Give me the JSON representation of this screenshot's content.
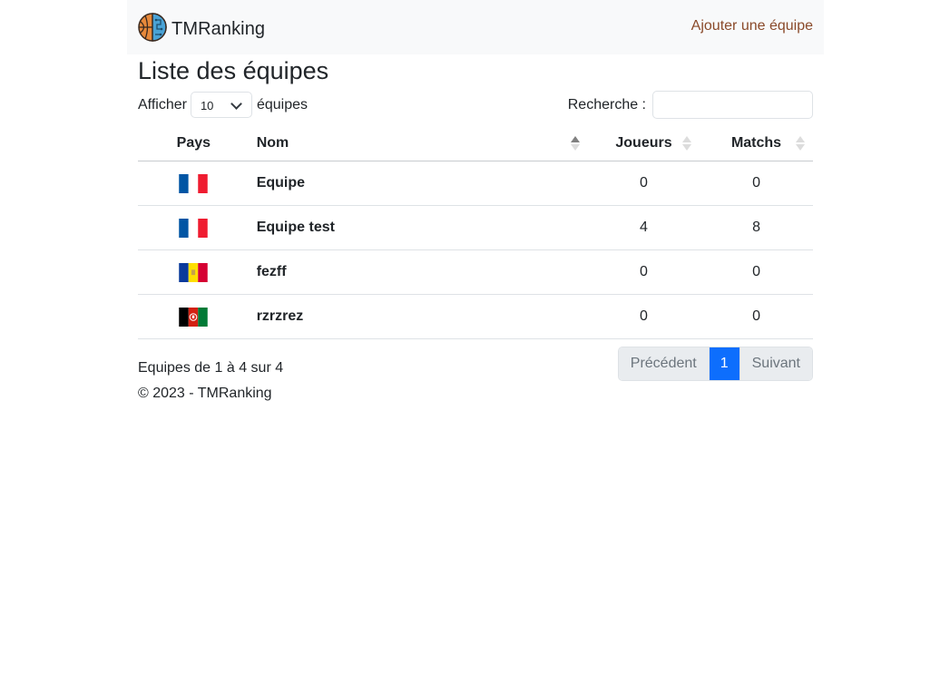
{
  "navbar": {
    "brand": "TMRanking",
    "add_team_link": "Ajouter une équipe",
    "logo_icon": "basketball-brain-logo-icon"
  },
  "page": {
    "title": "Liste des équipes"
  },
  "length_control": {
    "prefix": "Afficher",
    "selected": "10",
    "suffix": "équipes"
  },
  "search": {
    "label": "Recherche :",
    "value": "",
    "placeholder": ""
  },
  "table": {
    "headers": {
      "pays": "Pays",
      "nom": "Nom",
      "joueurs": "Joueurs",
      "matchs": "Matchs"
    },
    "sorted_column": "Nom",
    "rows": [
      {
        "flag": "France",
        "nom": "Equipe",
        "joueurs": "0",
        "matchs": "0"
      },
      {
        "flag": "France",
        "nom": "Equipe test",
        "joueurs": "4",
        "matchs": "8"
      },
      {
        "flag": "Andorra",
        "nom": "fezff",
        "joueurs": "0",
        "matchs": "0"
      },
      {
        "flag": "Afghanistan",
        "nom": "rzrzrez",
        "joueurs": "0",
        "matchs": "0"
      }
    ]
  },
  "info": "Equipes de 1 à 4 sur 4",
  "pagination": {
    "prev": "Précédent",
    "current": "1",
    "next": "Suivant"
  },
  "footer": "© 2023 - TMRanking",
  "colors": {
    "navbar_bg": "#f8f9fa",
    "link": "#8a4a2a",
    "active_page": "#0d6efd"
  }
}
